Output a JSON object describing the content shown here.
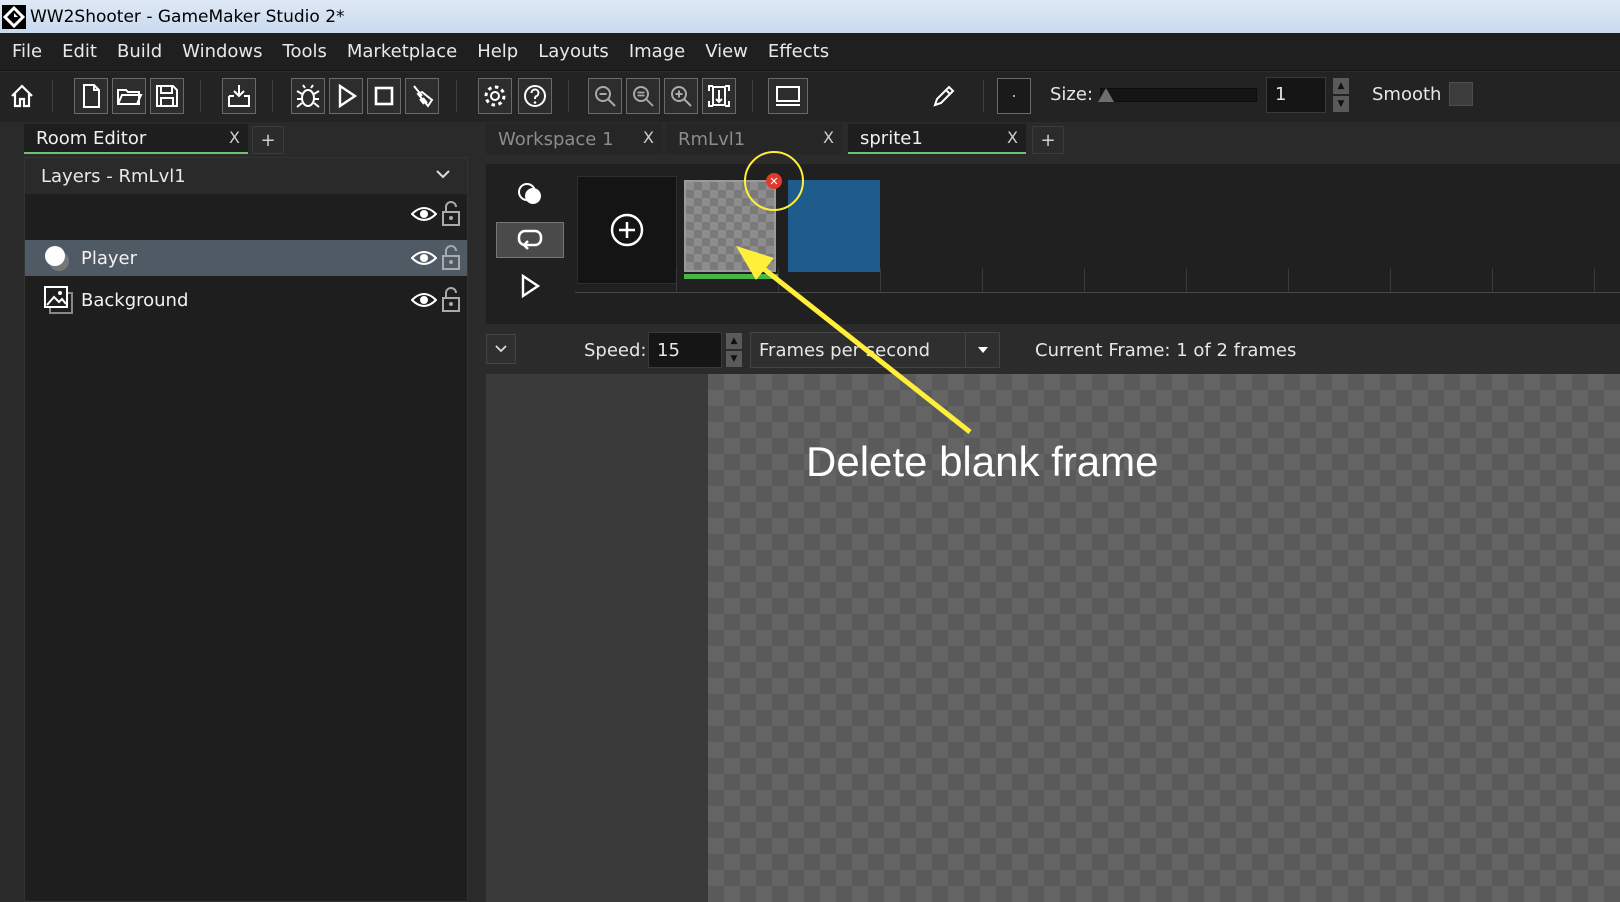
{
  "window": {
    "title": "WW2Shooter - GameMaker Studio 2*"
  },
  "menu": [
    "File",
    "Edit",
    "Build",
    "Windows",
    "Tools",
    "Marketplace",
    "Help",
    "Layouts",
    "Image",
    "View",
    "Effects"
  ],
  "toolbar": {
    "icons": [
      "home-icon",
      "new-file-icon",
      "open-folder-icon",
      "save-icon",
      "export-icon",
      "debug-bug-icon",
      "run-play-icon",
      "stop-icon",
      "clean-broom-icon",
      "settings-gear-icon",
      "help-icon",
      "zoom-out-icon",
      "zoom-reset-icon",
      "zoom-in-icon",
      "fit-window-icon",
      "monitor-icon",
      "pencil-icon"
    ],
    "size_label": "Size:",
    "size_value": "1",
    "smooth_label": "Smooth"
  },
  "left_tabs": [
    {
      "label": "Room Editor",
      "close": "X"
    }
  ],
  "layers": {
    "header": "Layers - RmLvl1",
    "items": [
      {
        "label": "Player",
        "icon": "instance-layer-icon",
        "selected": true
      },
      {
        "label": "Background",
        "icon": "background-layer-icon",
        "selected": false
      }
    ]
  },
  "right_tabs": [
    {
      "label": "Workspace 1",
      "close": "X"
    },
    {
      "label": "RmLvl1",
      "close": "X"
    },
    {
      "label": "sprite1",
      "close": "X"
    }
  ],
  "tab_plus": "+",
  "sprite_editor": {
    "speed_label": "Speed:",
    "speed_value": "15",
    "speed_unit": "Frames per second",
    "current_frame": "Current Frame: 1 of 2 frames",
    "frames": [
      {
        "color": "transparent"
      },
      {
        "color": "#1f5c8c"
      }
    ]
  },
  "annotation": {
    "text": "Delete blank frame",
    "color": "#ffef3a"
  }
}
